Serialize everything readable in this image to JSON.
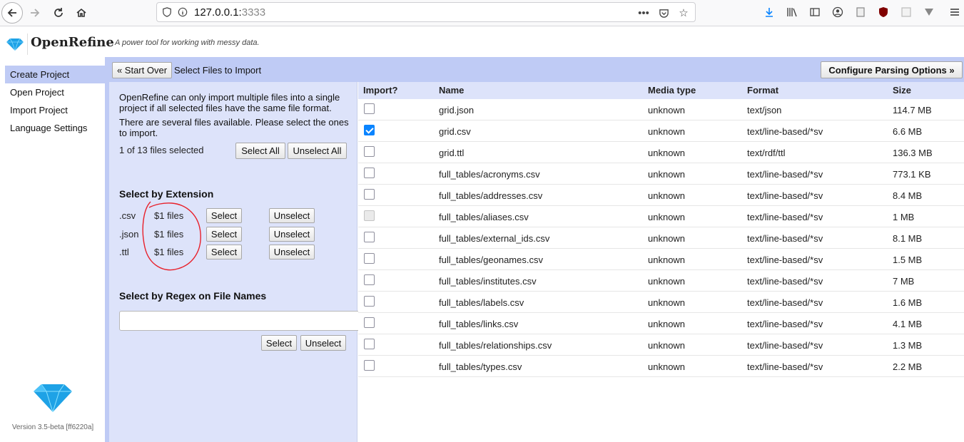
{
  "browser": {
    "url_host": "127.0.0.1:",
    "url_port": "3333"
  },
  "app": {
    "name": "OpenRefine",
    "tagline": "A power tool for working with messy data.",
    "version": "Version 3.5-beta [ff6220a]"
  },
  "sidebar": {
    "items": [
      {
        "label": "Create Project",
        "active": true
      },
      {
        "label": "Open Project"
      },
      {
        "label": "Import Project"
      },
      {
        "label": "Language Settings"
      }
    ]
  },
  "topbar": {
    "start_over": "« Start Over",
    "title": "Select Files to Import",
    "configure": "Configure Parsing Options »"
  },
  "selection": {
    "info_1": "OpenRefine can only import multiple files into a single project if all selected files have the same file format.",
    "info_2": "There are several files available. Please select the ones to import.",
    "count": "1 of 13 files selected",
    "select_all": "Select All",
    "unselect_all": "Unselect All",
    "by_extension_title": "Select by Extension",
    "extensions": [
      {
        "ext": ".csv",
        "count": "$1 files",
        "select": "Select",
        "unselect": "Unselect"
      },
      {
        "ext": ".json",
        "count": "$1 files",
        "select": "Select",
        "unselect": "Unselect"
      },
      {
        "ext": ".ttl",
        "count": "$1 files",
        "select": "Select",
        "unselect": "Unselect"
      }
    ],
    "by_regex_title": "Select by Regex on File Names",
    "regex_select": "Select",
    "regex_unselect": "Unselect"
  },
  "table": {
    "headers": {
      "import": "Import?",
      "name": "Name",
      "media": "Media type",
      "format": "Format",
      "size": "Size"
    },
    "rows": [
      {
        "name": "grid.json",
        "media": "unknown",
        "format": "text/json",
        "size": "114.7 MB",
        "checked": false
      },
      {
        "name": "grid.csv",
        "media": "unknown",
        "format": "text/line-based/*sv",
        "size": "6.6 MB",
        "checked": true
      },
      {
        "name": "grid.ttl",
        "media": "unknown",
        "format": "text/rdf/ttl",
        "size": "136.3 MB",
        "checked": false
      },
      {
        "name": "full_tables/acronyms.csv",
        "media": "unknown",
        "format": "text/line-based/*sv",
        "size": "773.1 KB",
        "checked": false
      },
      {
        "name": "full_tables/addresses.csv",
        "media": "unknown",
        "format": "text/line-based/*sv",
        "size": "8.4 MB",
        "checked": false
      },
      {
        "name": "full_tables/aliases.csv",
        "media": "unknown",
        "format": "text/line-based/*sv",
        "size": "1 MB",
        "checked": false
      },
      {
        "name": "full_tables/external_ids.csv",
        "media": "unknown",
        "format": "text/line-based/*sv",
        "size": "8.1 MB",
        "checked": false
      },
      {
        "name": "full_tables/geonames.csv",
        "media": "unknown",
        "format": "text/line-based/*sv",
        "size": "1.5 MB",
        "checked": false
      },
      {
        "name": "full_tables/institutes.csv",
        "media": "unknown",
        "format": "text/line-based/*sv",
        "size": "7 MB",
        "checked": false
      },
      {
        "name": "full_tables/labels.csv",
        "media": "unknown",
        "format": "text/line-based/*sv",
        "size": "1.6 MB",
        "checked": false
      },
      {
        "name": "full_tables/links.csv",
        "media": "unknown",
        "format": "text/line-based/*sv",
        "size": "4.1 MB",
        "checked": false
      },
      {
        "name": "full_tables/relationships.csv",
        "media": "unknown",
        "format": "text/line-based/*sv",
        "size": "1.3 MB",
        "checked": false
      },
      {
        "name": "full_tables/types.csv",
        "media": "unknown",
        "format": "text/line-based/*sv",
        "size": "2.2 MB",
        "checked": false
      }
    ]
  },
  "colors": {
    "panel": "#bfcbf5",
    "panel_light": "#dde3fa",
    "checkbox_checked": "#0a84ff",
    "annotation": "#e8202a"
  }
}
